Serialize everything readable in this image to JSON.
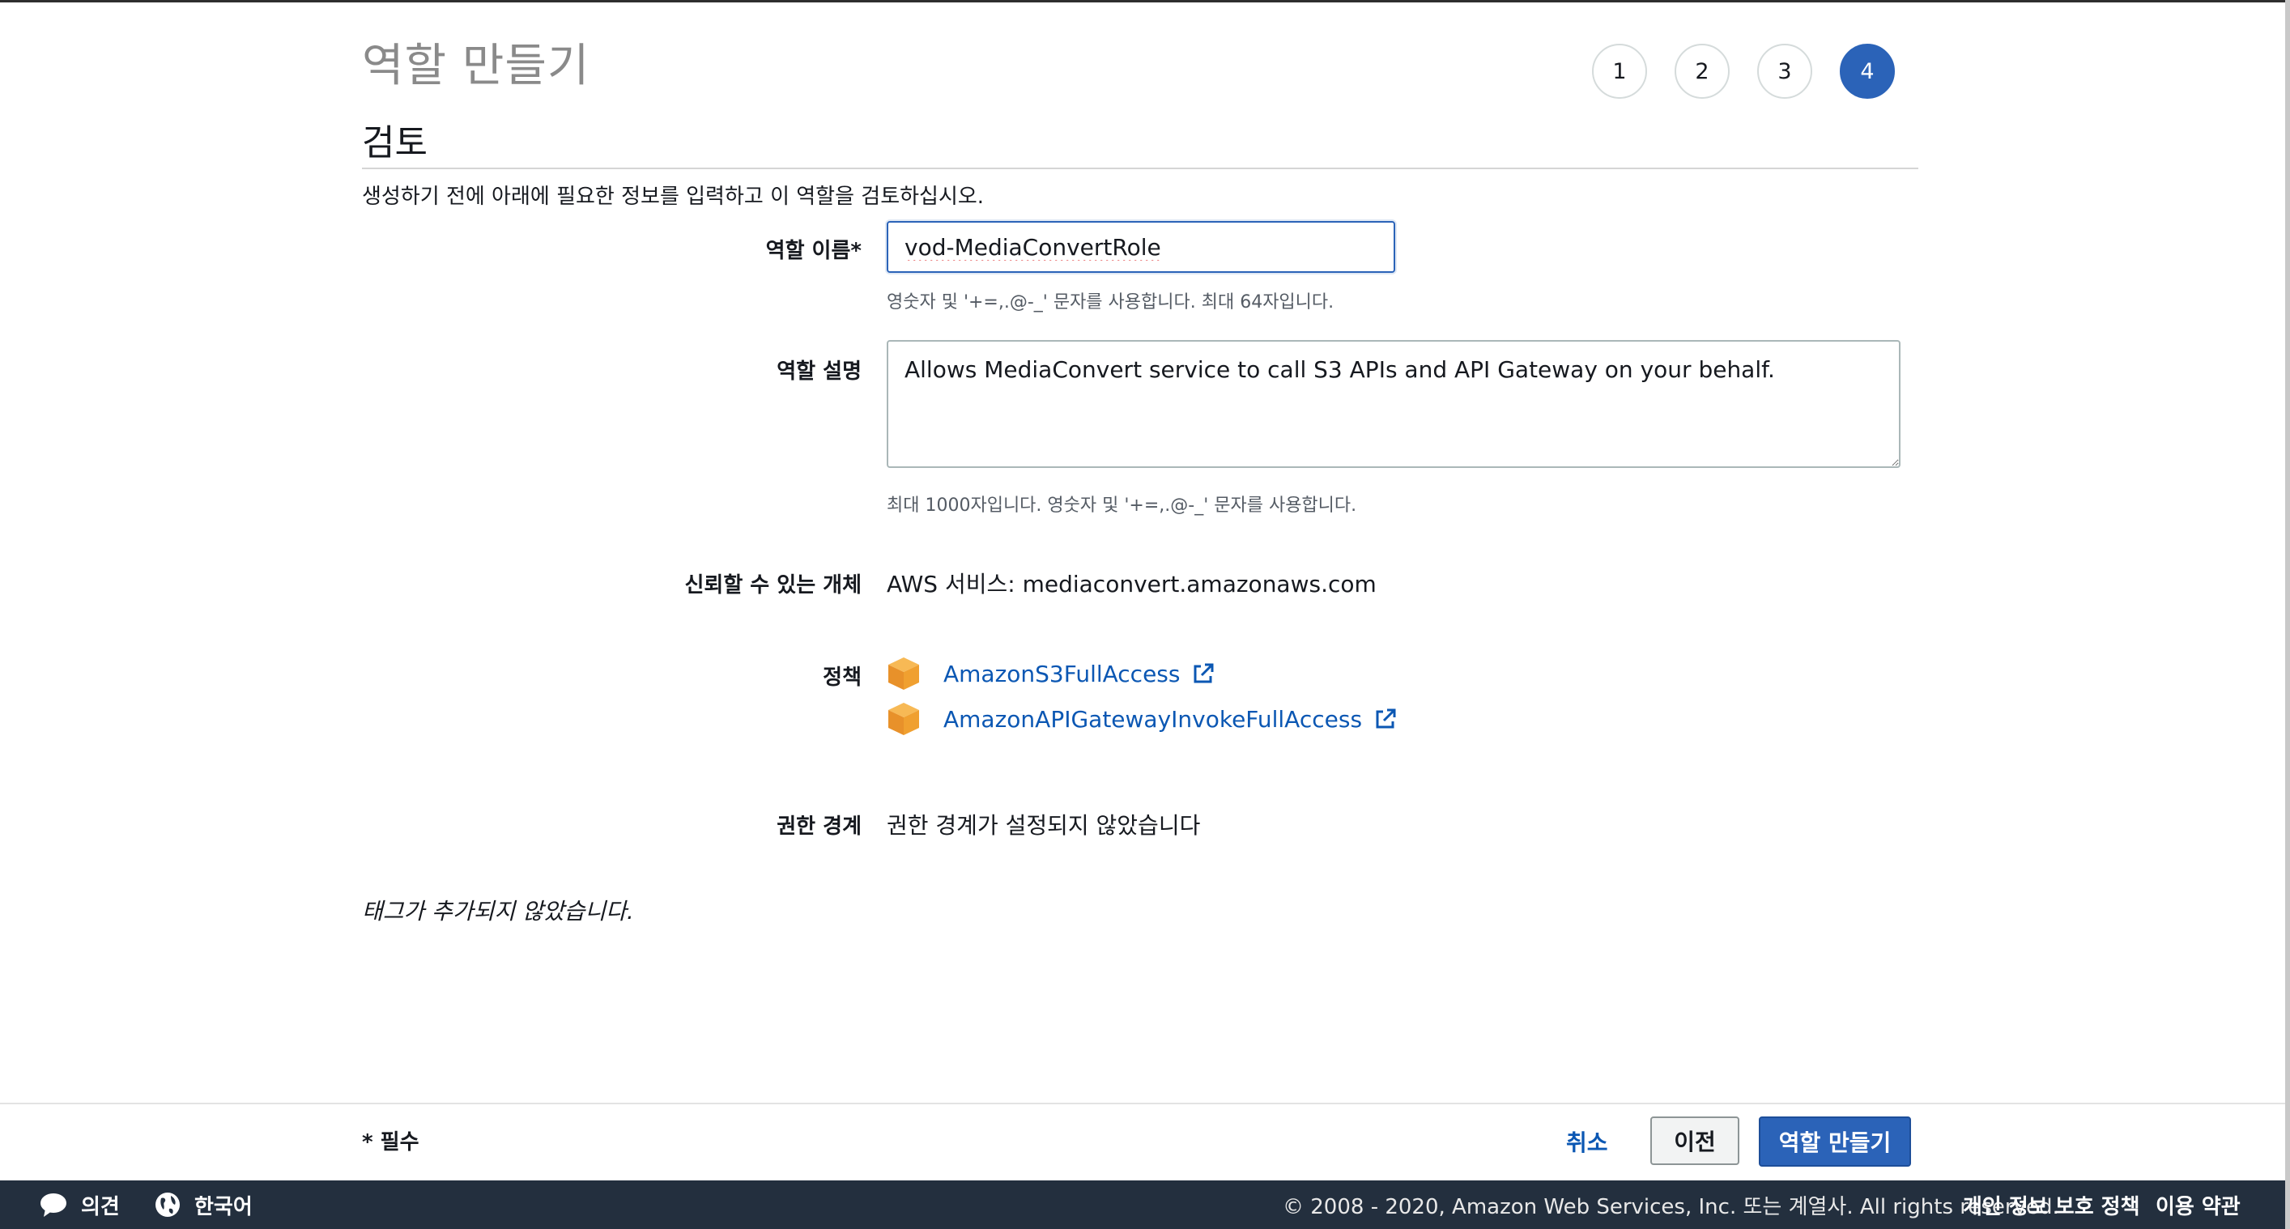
{
  "wizard": {
    "title": "역할 만들기",
    "steps": [
      "1",
      "2",
      "3",
      "4"
    ],
    "active_step": "4"
  },
  "review": {
    "heading": "검토",
    "intro": "생성하기 전에 아래에 필요한 정보를 입력하고 이 역할을 검토하십시오."
  },
  "role_name": {
    "label": "역할 이름*",
    "value": "vod-MediaConvertRole",
    "hint": "영숫자 및 '+=,.@-_' 문자를 사용합니다. 최대 64자입니다."
  },
  "role_description": {
    "label": "역할 설명",
    "value": "Allows MediaConvert service to call S3 APIs and API Gateway on your behalf.",
    "hint": "최대 1000자입니다. 영숫자 및 '+=,.@-_' 문자를 사용합니다."
  },
  "trusted_entity": {
    "label": "신뢰할 수 있는 개체",
    "value": "AWS 서비스: mediaconvert.amazonaws.com"
  },
  "policies": {
    "label": "정책",
    "items": [
      {
        "name": "AmazonS3FullAccess",
        "icon": "policy-box-icon"
      },
      {
        "name": "AmazonAPIGatewayInvokeFullAccess",
        "icon": "policy-box-icon"
      }
    ]
  },
  "permissions_boundary": {
    "label": "권한 경계",
    "value": "권한 경계가 설정되지 않았습니다"
  },
  "tags_note": "태그가 추가되지 않았습니다.",
  "footer": {
    "required_note": "* 필수",
    "cancel_label": "취소",
    "previous_label": "이전",
    "create_label": "역할 만들기"
  },
  "console_bar": {
    "feedback_label": "의견",
    "language_label": "한국어",
    "copyright": "© 2008 - 2020, Amazon Web Services, Inc. 또는 계열사. All rights reserved.",
    "privacy_label": "개인 정보 보호 정책",
    "terms_label": "이용 약관"
  },
  "colors": {
    "primary": "#2b63b8",
    "link": "#0b57b3",
    "policy_icon": "#f0a030",
    "bottom_bar": "#232f3e"
  }
}
